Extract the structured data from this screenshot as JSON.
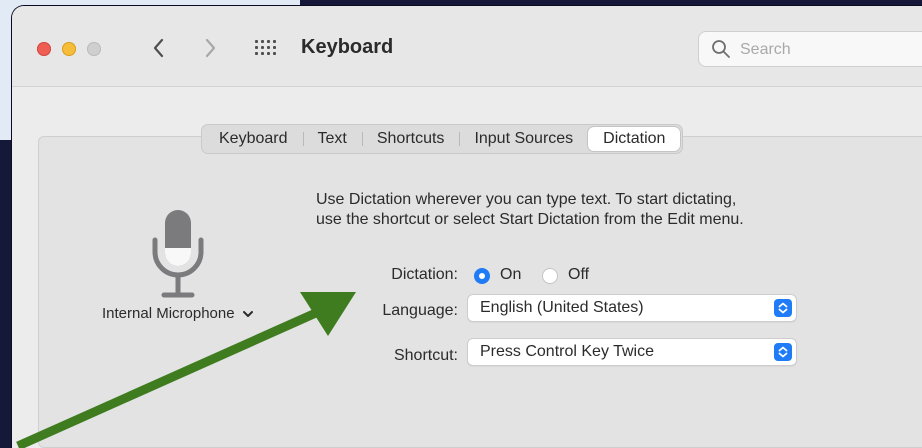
{
  "window": {
    "title": "Keyboard",
    "search_placeholder": "Search"
  },
  "tabs": [
    {
      "label": "Keyboard",
      "active": false
    },
    {
      "label": "Text",
      "active": false
    },
    {
      "label": "Shortcuts",
      "active": false
    },
    {
      "label": "Input Sources",
      "active": false
    },
    {
      "label": "Dictation",
      "active": true
    }
  ],
  "microphone": {
    "icon": "microphone-icon",
    "source_label": "Internal Microphone",
    "chevron": "chevron-down-icon"
  },
  "dictation": {
    "description_line1": "Use Dictation wherever you can type text. To start dictating,",
    "description_line2": "use the shortcut or select Start Dictation from the Edit menu.",
    "dictation_label": "Dictation:",
    "on_label": "On",
    "off_label": "Off",
    "selected": "On",
    "language_label": "Language:",
    "language_value": "English (United States)",
    "shortcut_label": "Shortcut:",
    "shortcut_value": "Press Control Key Twice"
  },
  "colors": {
    "accent": "#1f7cf6",
    "annotation_arrow": "#3f7c1f",
    "close": "#ee5e55",
    "minimize": "#f6bd3b",
    "zoom_disabled": "#cfcfcf"
  }
}
